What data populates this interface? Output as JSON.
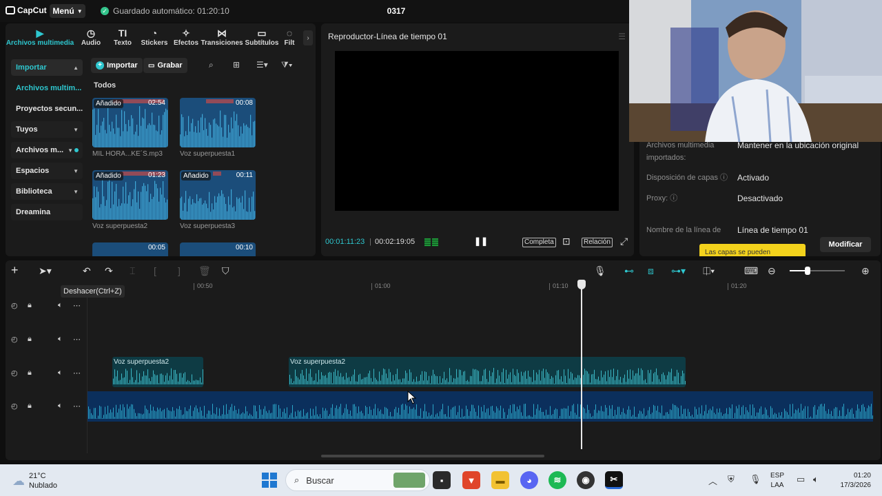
{
  "app": {
    "logo_text": "CapCut",
    "menu_label": "Menú",
    "autosave_text": "Guardado automático: 01:20:10",
    "project_title": "0317"
  },
  "media": {
    "tabs": [
      {
        "label": "Archivos multimedia",
        "icon": "media-icon",
        "active": true
      },
      {
        "label": "Audio",
        "icon": "audio-icon"
      },
      {
        "label": "Texto",
        "icon": "text-icon"
      },
      {
        "label": "Stickers",
        "icon": "sticker-icon"
      },
      {
        "label": "Efectos",
        "icon": "effects-icon"
      },
      {
        "label": "Transiciones",
        "icon": "transitions-icon"
      },
      {
        "label": "Subtítulos",
        "icon": "subtitles-icon"
      },
      {
        "label": "Filt",
        "icon": "filters-icon"
      }
    ],
    "sidebar": [
      {
        "label": "Importar",
        "chev": "▲"
      },
      {
        "label": "Archivos multim...",
        "chev": ""
      },
      {
        "label": "Proyectos secun...",
        "chev": ""
      },
      {
        "label": "Tuyos",
        "chev": "▼"
      },
      {
        "label": "Archivos m...",
        "chev": "▼"
      },
      {
        "label": "Espacios",
        "chev": "▼"
      },
      {
        "label": "Biblioteca",
        "chev": "▼"
      },
      {
        "label": "Dreamina",
        "chev": ""
      }
    ],
    "import_label": "Importar",
    "record_label": "Grabar",
    "section_label": "Todos",
    "added_label": "Añadido",
    "clips": [
      {
        "name": "MIL HORA...KE´S.mp3",
        "duration": "02:54",
        "added": true
      },
      {
        "name": "Voz superpuesta1",
        "duration": "00:08",
        "added": false
      },
      {
        "name": "Voz superpuesta2",
        "duration": "01:23",
        "added": true
      },
      {
        "name": "Voz superpuesta3",
        "duration": "00:11",
        "added": true
      },
      {
        "name": "",
        "duration": "00:05",
        "added": false
      },
      {
        "name": "",
        "duration": "00:10",
        "added": false
      }
    ]
  },
  "player": {
    "title": "Reproductor-Línea de tiempo 01",
    "current_time": "00:01:11:23",
    "total_time": "00:02:19:05",
    "full_label": "Completa",
    "ratio_label": "Relación"
  },
  "props": {
    "rows": [
      {
        "label": "Archivos multimedia importados:",
        "value": "Mantener en la ubicación original"
      },
      {
        "label": "Disposición de capas ⓘ",
        "value": "Activado"
      },
      {
        "label": "Proxy: ⓘ",
        "value": "Desactivado"
      },
      {
        "label": "Nombre de la línea de",
        "value": "Línea de tiempo 01"
      }
    ],
    "yellow_tip": "Las capas se pueden",
    "modify_label": "Modificar"
  },
  "timeline": {
    "undo_tooltip": "Deshacer(Ctrl+Z)",
    "ruler_ticks": [
      "00:50",
      "01:00",
      "01:10",
      "01:20"
    ],
    "clips": [
      {
        "label": "Voz superpuesta2"
      },
      {
        "label": "Voz superpuesta2"
      }
    ]
  },
  "taskbar": {
    "temperature": "21°C",
    "weather": "Nublado",
    "search_placeholder": "Buscar",
    "lang_top": "ESP",
    "lang_bottom": "LAA",
    "time": "01:20",
    "date": "17/3/2026"
  },
  "colors": {
    "accent": "#2ec7cf",
    "panel": "#1b1b1b",
    "audio_clip": "#0e3b44",
    "main_track": "#0b2f5c"
  }
}
